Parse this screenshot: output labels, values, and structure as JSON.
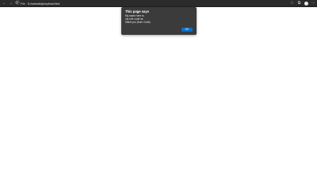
{
  "toolbar": {
    "page_info_label": "File",
    "url": "D:/website/js/myfinal.html"
  },
  "dialog": {
    "title": "This page says",
    "lines": [
      "My name here is",
      "my role code as",
      "thank you (from Code)"
    ],
    "ok_label": "OK"
  },
  "colors": {
    "toolbar": "#2b2b2b",
    "dialog_bg": "#3b3b3b",
    "ok_button": "#0b6fc8",
    "page_bg": "#ffffff"
  },
  "icons": [
    "back-icon",
    "forward-icon",
    "reload-icon",
    "info-icon",
    "favorite-icon",
    "extensions-icon",
    "profile-icon",
    "menu-icon"
  ]
}
